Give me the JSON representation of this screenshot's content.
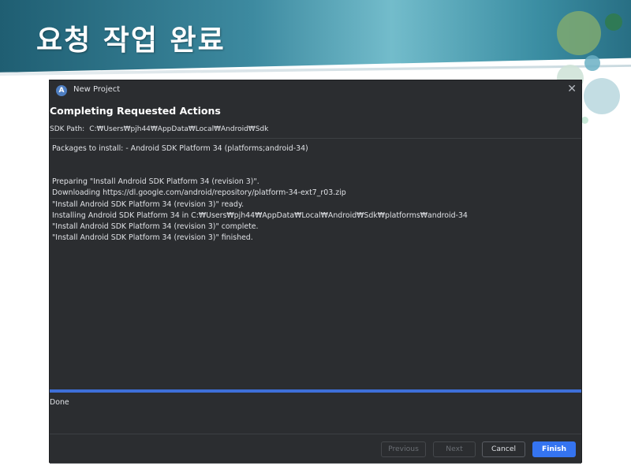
{
  "slide": {
    "title": "요청 작업 완료"
  },
  "dialog": {
    "window_title": "New Project",
    "app_icon_glyph": "A",
    "close_glyph": "✕",
    "heading": "Completing Requested Actions",
    "sdk_path_label": "SDK Path:",
    "sdk_path_value": "C:₩Users₩pjh44₩AppData₩Local₩Android₩Sdk",
    "packages_line": "Packages to install: - Android SDK Platform 34 (platforms;android-34)",
    "log": [
      "Preparing \"Install Android SDK Platform 34 (revision 3)\".",
      "Downloading https://dl.google.com/android/repository/platform-34-ext7_r03.zip",
      "\"Install Android SDK Platform 34 (revision 3)\" ready.",
      "Installing Android SDK Platform 34 in C:₩Users₩pjh44₩AppData₩Local₩Android₩Sdk₩platforms₩android-34",
      "\"Install Android SDK Platform 34 (revision 3)\" complete.",
      "\"Install Android SDK Platform 34 (revision 3)\" finished."
    ],
    "progress_fraction": 1.0,
    "status": "Done",
    "buttons": {
      "previous": "Previous",
      "next": "Next",
      "cancel": "Cancel",
      "finish": "Finish"
    }
  },
  "colors": {
    "dialog_bg": "#2b2d30",
    "accent": "#3574f0",
    "progress": "#3e6fd8"
  },
  "icons": {
    "app_icon": "android-studio-icon",
    "close_icon": "close-icon"
  }
}
